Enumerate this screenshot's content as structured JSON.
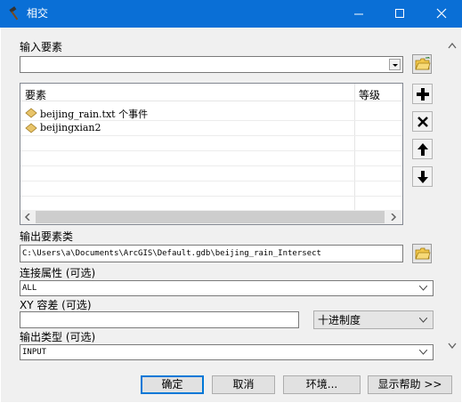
{
  "window": {
    "title": "相交",
    "icons": {
      "title": "hammer-icon",
      "minimize": "minimize-icon",
      "maximize": "maximize-icon",
      "close": "close-icon"
    },
    "titlebar_color": "#0a6fd6"
  },
  "input_features": {
    "label": "输入要素",
    "value": "",
    "columns": {
      "features": "要素",
      "rank": "等级"
    },
    "items": [
      {
        "name": "beijing_rain.txt 个事件",
        "rank": ""
      },
      {
        "name": "beijingxian2",
        "rank": ""
      }
    ],
    "side_buttons": [
      "add-icon",
      "remove-icon",
      "move-up-icon",
      "move-down-icon"
    ]
  },
  "output": {
    "label": "输出要素类",
    "value": "C:\\Users\\a\\Documents\\ArcGIS\\Default.gdb\\beijing_rain_Intersect"
  },
  "join_attributes": {
    "label": "连接属性 (可选)",
    "value": "ALL"
  },
  "xy_tolerance": {
    "label": "XY 容差 (可选)",
    "value": "",
    "unit": "十进制度"
  },
  "output_type": {
    "label": "输出类型 (可选)",
    "value": "INPUT"
  },
  "buttons": {
    "ok": "确定",
    "cancel": "取消",
    "environments": "环境...",
    "help": "显示帮助 >>"
  }
}
